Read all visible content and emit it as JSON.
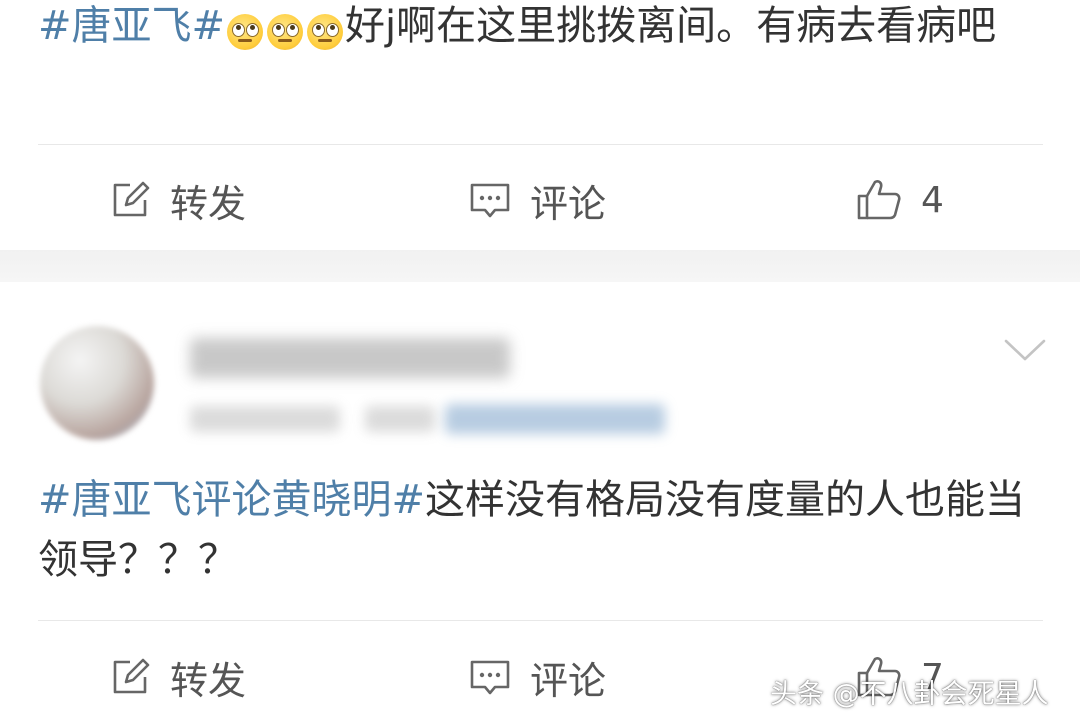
{
  "post1": {
    "hashtag": "#唐亚飞#",
    "emojis": [
      "eye-roll-emoji",
      "eye-roll-emoji",
      "eye-roll-emoji"
    ],
    "text": "好j啊在这里挑拨离间。有病去看病吧",
    "actions": {
      "repost_label": "转发",
      "comment_label": "评论",
      "like_count": "4"
    }
  },
  "post2": {
    "hashtag": "#唐亚飞评论黄晓明#",
    "text": "这样没有格局没有度量的人也能当领导？？？",
    "actions": {
      "repost_label": "转发",
      "comment_label": "评论",
      "like_count": "7"
    }
  },
  "watermark": "头条 @不八卦会死星人",
  "colors": {
    "hashtag": "#4f7fa8",
    "text": "#333333",
    "action": "#555555",
    "divider": "#e8e8e8"
  }
}
